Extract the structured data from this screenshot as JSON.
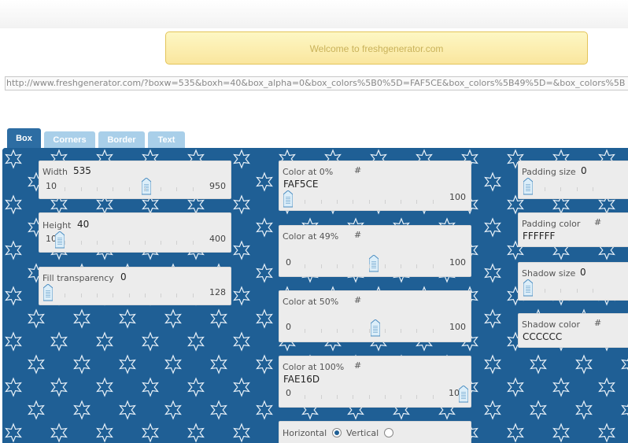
{
  "preview": {
    "text": "Welcome to freshgenerator.com"
  },
  "url": {
    "value": "http://www.freshgenerator.com/?boxw=535&boxh=40&box_alpha=0&box_colors%5B0%5D=FAF5CE&box_colors%5B49%5D=&box_colors%5B"
  },
  "tabs": [
    {
      "label": "Box",
      "active": true
    },
    {
      "label": "Corners",
      "active": false
    },
    {
      "label": "Border",
      "active": false
    },
    {
      "label": "Text",
      "active": false
    }
  ],
  "colors": {
    "panel": "#1f5f95",
    "tab_active": "#2d6da3",
    "tab_inactive": "#a9cfe9",
    "preview_bg": "#fae69e"
  },
  "box": {
    "width": {
      "label": "Width",
      "value": "535",
      "min": "10",
      "max": "950"
    },
    "height": {
      "label": "Height",
      "value": "40",
      "min": "10",
      "max": "400"
    },
    "fill": {
      "label": "Fill transparency",
      "value": "0",
      "min": "",
      "max": "128"
    }
  },
  "gradient": {
    "stop0": {
      "label": "Color at 0%",
      "hash": "#",
      "hex": "FAF5CE",
      "min": "",
      "max": "100",
      "level": 0
    },
    "stop49": {
      "label": "Color at 49%",
      "hash": "#",
      "hex": "",
      "min": "0",
      "max": "100",
      "level": 49
    },
    "stop50": {
      "label": "Color at 50%",
      "hash": "#",
      "hex": "",
      "min": "0",
      "max": "100",
      "level": 50
    },
    "stop100": {
      "label": "Color at 100%",
      "hash": "#",
      "hex": "FAE16D",
      "min": "0",
      "max": "10",
      "level": 100
    },
    "orientation": {
      "horizontal": "Horizontal",
      "vertical": "Vertical",
      "selected": "Horizontal"
    }
  },
  "padding": {
    "size_label": "Padding size",
    "size_value": "0",
    "color_label": "Padding color",
    "hash": "#",
    "color_value": "FFFFFF"
  },
  "shadow": {
    "size_label": "Shadow size",
    "size_value": "0",
    "color_label": "Shadow color",
    "hash": "#",
    "color_value": "CCCCCC"
  }
}
